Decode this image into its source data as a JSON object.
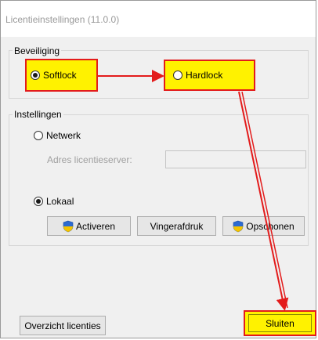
{
  "window": {
    "title": "Licentieinstellingen (11.0.0)"
  },
  "security": {
    "group_label": "Beveiliging",
    "softlock_label": "Softlock",
    "softlock_checked": true,
    "hardlock_label": "Hardlock",
    "hardlock_checked": false
  },
  "settings": {
    "group_label": "Instellingen",
    "network_label": "Netwerk",
    "network_checked": false,
    "server_address_label": "Adres licentieserver:",
    "server_address_value": "",
    "local_label": "Lokaal",
    "local_checked": true,
    "activate_label": "Activeren",
    "fingerprint_label": "Vingerafdruk",
    "cleanup_label": "Opschonen"
  },
  "footer": {
    "overview_label": "Overzicht licenties",
    "close_label": "Sluiten"
  },
  "colors": {
    "highlight": "#fff200",
    "annotation": "#e31b1b",
    "shield_blue": "#2d6bd2",
    "shield_yellow": "#f5c400"
  },
  "icons": [
    "shield-icon",
    "arrow-icon"
  ]
}
